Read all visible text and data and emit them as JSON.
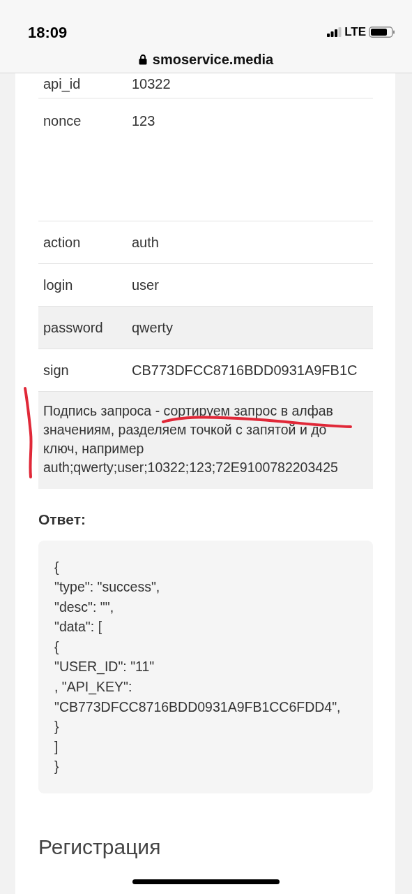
{
  "status_bar": {
    "time": "18:09",
    "network": "LTE"
  },
  "address_bar": {
    "url": "smoservice.media"
  },
  "params_table": {
    "rows": [
      {
        "key": "api_id",
        "value": "10322",
        "shaded": false,
        "kind": "short"
      },
      {
        "key": "nonce",
        "value": "123",
        "shaded": false,
        "kind": "tall"
      },
      {
        "key": "action",
        "value": "auth",
        "shaded": false,
        "kind": "normal"
      },
      {
        "key": "login",
        "value": "user",
        "shaded": false,
        "kind": "normal"
      },
      {
        "key": "password",
        "value": "qwerty",
        "shaded": true,
        "kind": "normal"
      },
      {
        "key": "sign",
        "value": "CB773DFCC8716BDD0931A9FB1C",
        "shaded": false,
        "kind": "normal"
      }
    ],
    "description": {
      "shaded": true,
      "lines": [
        "Подпись запроса - сортируем запрос в алфав",
        "значениям, разделяем точкой с запятой и до",
        "ключ, например",
        "auth;qwerty;user;10322;123;72E9100782203425"
      ]
    }
  },
  "response": {
    "heading": "Ответ:",
    "code_lines": [
      "{",
      "\"type\": \"success\",",
      "\"desc\": \"\",",
      "\"data\": [",
      "{",
      "\"USER_ID\": \"11\"",
      ", \"API_KEY\":",
      "\"CB773DFCC8716BDD0931A9FB1CC6FDD4\",",
      "}",
      "]",
      "}"
    ]
  },
  "next_section": {
    "heading": "Регистрация"
  },
  "hand_markup": {
    "side_bracket": true,
    "underline": true
  }
}
